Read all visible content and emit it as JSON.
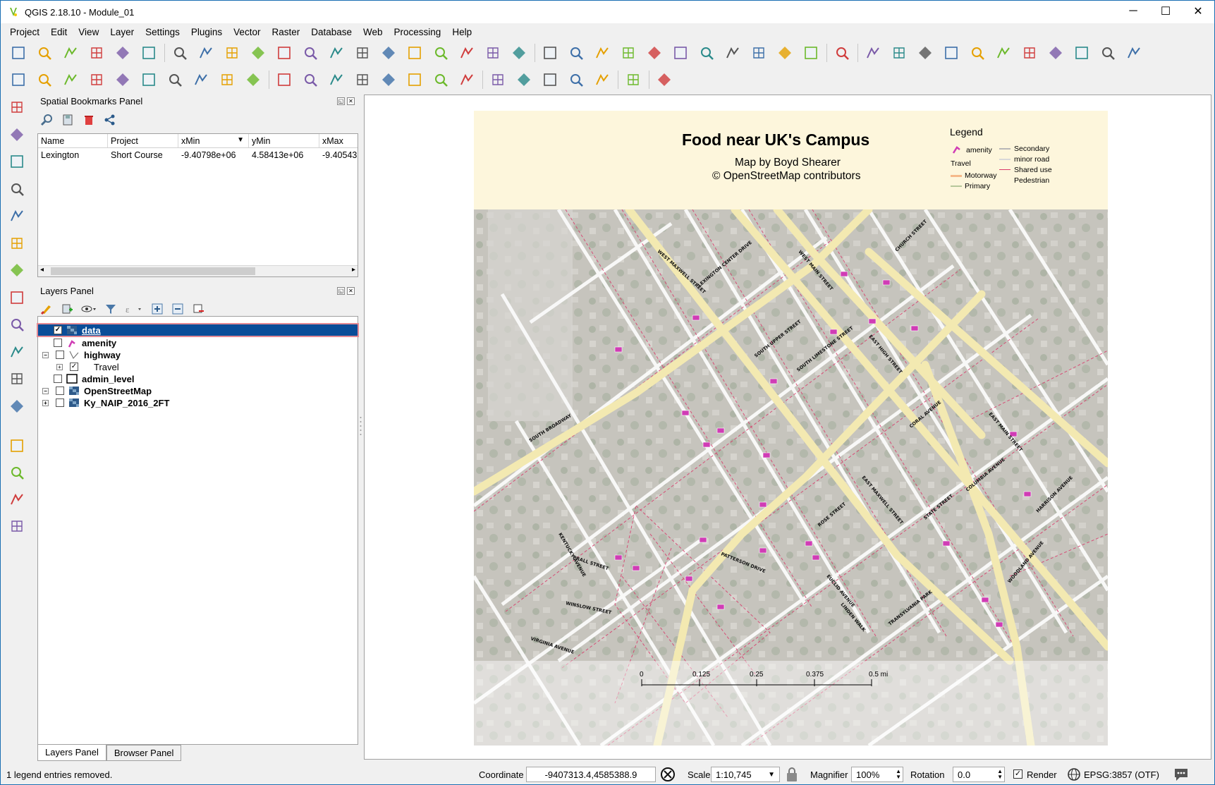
{
  "window": {
    "title": "QGIS 2.18.10 - Module_01",
    "controls": {
      "minimize": "─",
      "maximize": "☐",
      "close": "✕"
    }
  },
  "menu": [
    "Project",
    "Edit",
    "View",
    "Layer",
    "Settings",
    "Plugins",
    "Vector",
    "Raster",
    "Database",
    "Web",
    "Processing",
    "Help"
  ],
  "toolbar_icons": {
    "row1": [
      "new-project-icon",
      "open-project-icon",
      "save-project-icon",
      "save-as-icon",
      "new-print-composer-icon",
      "composer-manager-icon",
      "touch-zoom-icon",
      "pan-icon",
      "pan-to-selection-icon",
      "zoom-in-icon",
      "zoom-out-icon",
      "zoom-native-icon",
      "zoom-full-icon",
      "zoom-selection-icon",
      "zoom-layer-icon",
      "zoom-last-icon",
      "zoom-next-icon",
      "new-bookmark-icon",
      "show-bookmarks-icon",
      "refresh-icon",
      "identify-icon",
      "action-icon",
      "select-features-icon",
      "select-expression-icon",
      "deselect-icon",
      "attribute-table-icon",
      "field-calculator-icon",
      "statistics-icon",
      "measure-icon",
      "map-tips-icon",
      "text-annotation-icon",
      "help-icon",
      "raster-histogram-icon",
      "raster-cumulative-icon",
      "raster-stretch-icon",
      "raster-local-icon",
      "sun-icon",
      "sun-plus-icon",
      "globe-icon",
      "globe-plus-icon",
      "grid-icon",
      "circle-icon",
      "image-icon"
    ],
    "row2": [
      "current-edits-icon",
      "toggle-editing-icon",
      "save-edits-icon",
      "add-feature-icon",
      "move-feature-icon",
      "node-tool-icon",
      "delete-selected-icon",
      "cut-features-icon",
      "copy-features-icon",
      "paste-features-icon",
      "label-abc-icon",
      "diagram-icon",
      "label-highlight-icon",
      "label-pin-icon",
      "label-show-icon",
      "label-move-icon",
      "label-rotate-icon",
      "label-change-icon",
      "db-manager-icon",
      "db-import-icon",
      "db-export-icon",
      "metasearch-icon",
      "csw-icon",
      "python-console-icon",
      "georeferencer-icon"
    ],
    "left": [
      "add-vector-icon",
      "add-raster-icon",
      "add-spatialite-icon",
      "add-postgis-icon",
      "add-wms-icon",
      "add-wcs-icon",
      "add-wfs-icon",
      "add-delimited-icon",
      "add-virtual-layer-icon",
      "add-oracle-icon",
      "new-shapefile-icon",
      "add-gps-icon",
      "digitize-point-icon",
      "node-editor-icon",
      "capture-icon",
      "offset-curve-icon"
    ]
  },
  "bookmarks_panel": {
    "title": "Spatial Bookmarks Panel",
    "columns": [
      "Name",
      "Project",
      "xMin",
      "yMin",
      "xMax"
    ],
    "rows": [
      {
        "name": "Lexington",
        "project": "Short Course",
        "xmin": "-9.40798e+06",
        "ymin": "4.58413e+06",
        "xmax": "-9.40543"
      }
    ]
  },
  "layers_panel": {
    "title": "Layers Panel",
    "layers": [
      {
        "name": "data",
        "checked": "✓",
        "expand": "",
        "selected": true
      },
      {
        "name": "amenity",
        "checked": "",
        "expand": ""
      },
      {
        "name": "highway",
        "checked": "",
        "expand": "−"
      },
      {
        "name": "Travel",
        "checked": "✓",
        "expand": "+"
      },
      {
        "name": "admin_level",
        "checked": "",
        "expand": ""
      },
      {
        "name": "OpenStreetMap",
        "checked": "",
        "expand": "−"
      },
      {
        "name": "Ky_NAIP_2016_2FT",
        "checked": "",
        "expand": "+"
      }
    ]
  },
  "bottom_tabs": [
    "Layers Panel",
    "Browser Panel"
  ],
  "map_layout": {
    "title": "Food near UK's Campus",
    "subtitle": "Map by Boyd Shearer",
    "credit": "© OpenStreetMap contributors",
    "legend": {
      "title": "Legend",
      "items": [
        {
          "label": "amenity",
          "color": "#d03cb5"
        },
        {
          "label": "Travel",
          "color": ""
        },
        {
          "label": "Motorway",
          "color": "#f5b98a"
        },
        {
          "label": "Primary",
          "color": "#b6c79a"
        },
        {
          "label": "Secondary",
          "color": "#b8b8b8"
        },
        {
          "label": "minor road",
          "color": "#d8d8d8"
        },
        {
          "label": "Shared use",
          "color": "#d9396a"
        },
        {
          "label": "Pedestrian",
          "color": "#e0e0e0"
        }
      ]
    },
    "scalebar": [
      "0",
      "0.125",
      "0.25",
      "0.375",
      "0.5 mi"
    ],
    "street_labels": [
      "WEST MAXWELL STREET",
      "LEXINGTON CENTER DRIVE",
      "SOUTH BROADWAY",
      "SOUTH UPPER STREET",
      "SOUTH LIMESTONE STREET",
      "EAST MAXWELL STREET",
      "EAST HIGH STREET",
      "VIRGINIA AVENUE",
      "PATTERSON DRIVE",
      "ROSE STREET",
      "WOODLAND AVENUE",
      "EAST MAIN STREET",
      "WEST MAIN STREET",
      "CHURCH STREET",
      "CORAL AVENUE",
      "EUCLID AVENUE",
      "STATE STREET",
      "COLUMBIA AVENUE",
      "LINDEN WALK",
      "TRANSYLVANIA PARK",
      "KENTUCKY AVENUE",
      "HARRISON AVENUE",
      "WINSLOW STREET",
      "PRALL STREET"
    ]
  },
  "status_bar": {
    "message": "1 legend entries removed.",
    "coordinate_label": "Coordinate",
    "coordinate_value": "-9407313.4,4585388.9",
    "scale_label": "Scale",
    "scale_value": "1:10,745",
    "magnifier_label": "Magnifier",
    "magnifier_value": "100%",
    "rotation_label": "Rotation",
    "rotation_value": "0.0",
    "render_label": "Render",
    "render_checked": "✓",
    "crs": "EPSG:3857 (OTF)"
  },
  "colors": {
    "selection": "#0a4d98",
    "map_road_primary": "#f3e9b1",
    "map_road_minor": "#ffffff",
    "map_shared_use": "#d9396a",
    "map_amenity": "#d03cb5",
    "header_band": "#fdf6dc"
  }
}
